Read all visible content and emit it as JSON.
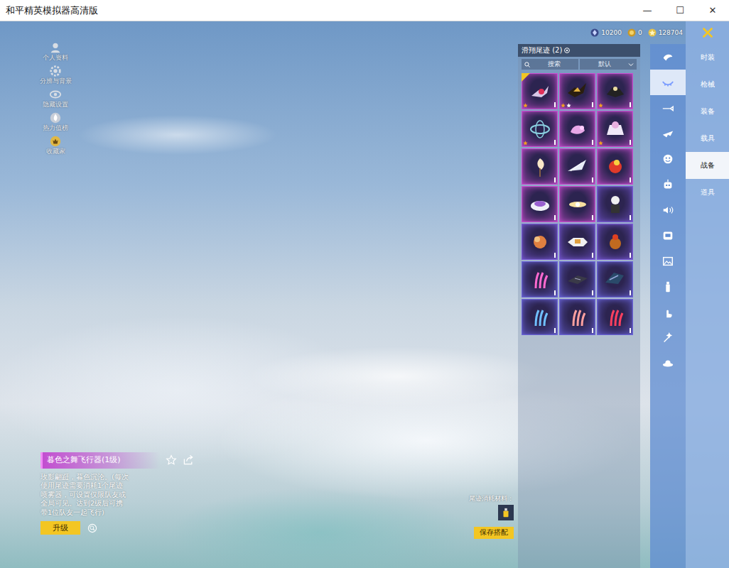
{
  "window": {
    "title": "和平精英模拟器高清版",
    "controls": [
      "—",
      "☐",
      "✕"
    ]
  },
  "left_menu": [
    {
      "label": "个人资料"
    },
    {
      "label": "分辨与背景"
    },
    {
      "label": "隐藏设置"
    },
    {
      "label": "热力值榜"
    },
    {
      "label": "收藏家"
    }
  ],
  "currencies": [
    {
      "value": "10200"
    },
    {
      "value": "0"
    },
    {
      "value": "128704"
    }
  ],
  "nav": [
    {
      "label": "时装",
      "selected": false
    },
    {
      "label": "枪械",
      "selected": false
    },
    {
      "label": "装备",
      "selected": false
    },
    {
      "label": "载具",
      "selected": false
    },
    {
      "label": "战备",
      "selected": true
    },
    {
      "label": "道具",
      "selected": false
    }
  ],
  "category_icons": [
    {
      "selected": false
    },
    {
      "selected": true
    },
    {
      "selected": false
    },
    {
      "selected": false
    },
    {
      "selected": false
    },
    {
      "selected": false
    },
    {
      "selected": false
    },
    {
      "selected": false
    },
    {
      "selected": false
    },
    {
      "selected": false
    },
    {
      "selected": false
    },
    {
      "selected": false
    },
    {
      "selected": false
    }
  ],
  "panel": {
    "title": "滑翔尾迹 (2)",
    "search_placeholder": "搜索",
    "sort": "默认",
    "items": [
      {
        "color": "#c84fd0",
        "new": true,
        "stars": 1
      },
      {
        "color": "#c84fd0",
        "new": false,
        "stars": 2
      },
      {
        "color": "#c84fd0",
        "new": false,
        "stars": 1
      },
      {
        "color": "#c84fd0",
        "new": false,
        "stars": 1
      },
      {
        "color": "#c84fd0",
        "new": false,
        "stars": 0
      },
      {
        "color": "#c84fd0",
        "new": false,
        "stars": 1
      },
      {
        "color": "#c84fd0",
        "new": false,
        "stars": 0
      },
      {
        "color": "#c84fd0",
        "new": false,
        "stars": 0
      },
      {
        "color": "#c84fd0",
        "new": false,
        "stars": 0
      },
      {
        "color": "#c84fd0",
        "new": false,
        "stars": 0
      },
      {
        "color": "#c84fd0",
        "new": false,
        "stars": 0
      },
      {
        "color": "#7a5ad8",
        "new": false,
        "stars": 0
      },
      {
        "color": "#7a5ad8",
        "new": false,
        "stars": 0
      },
      {
        "color": "#7a5ad8",
        "new": false,
        "stars": 0
      },
      {
        "color": "#7a5ad8",
        "new": false,
        "stars": 0
      },
      {
        "color": "#6a64d8",
        "new": false,
        "stars": 0
      },
      {
        "color": "#6a64d8",
        "new": false,
        "stars": 0
      },
      {
        "color": "#6a64d8",
        "new": false,
        "stars": 0
      },
      {
        "color": "#6a64d8",
        "new": false,
        "stars": 0
      },
      {
        "color": "#6a64d8",
        "new": false,
        "stars": 0
      },
      {
        "color": "#6a64d8",
        "new": false,
        "stars": 0
      }
    ]
  },
  "detail": {
    "name": "暮色之舞飞行器(1级)",
    "description": "玫影翩跹，暮色沉沦。(每次使用尾迹需要消耗1个尾迹喷雾器，可设置仅限队友或全局可见。达到2级后可携带1位队友一起飞行)",
    "upgrade_button": "升级"
  },
  "footer": {
    "material_label": "尾迹消耗材料：",
    "save_button": "保存搭配"
  }
}
